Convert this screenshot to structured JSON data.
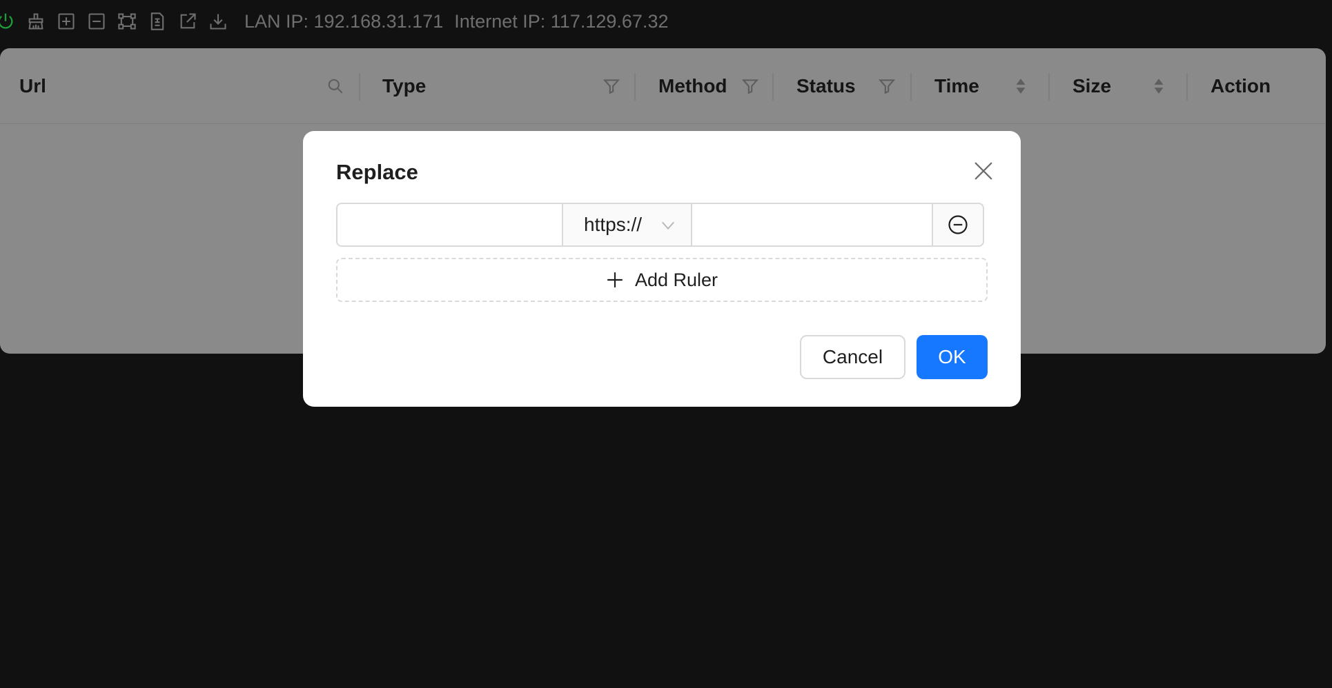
{
  "toolbar": {
    "icons": [
      "power-icon",
      "clear-icon",
      "expand-all-icon",
      "collapse-all-icon",
      "full-screen-icon",
      "copy-file-icon",
      "open-external-icon",
      "download-icon"
    ],
    "lan_ip": "LAN IP: 192.168.31.171",
    "internet_ip": "Internet IP: 117.129.67.32",
    "power_color": "#1f9d3a"
  },
  "table": {
    "columns": [
      {
        "label": "Url",
        "icon": "search-icon"
      },
      {
        "label": "Type",
        "icon": "filter-icon"
      },
      {
        "label": "Method",
        "icon": "filter-icon"
      },
      {
        "label": "Status",
        "icon": "filter-icon"
      },
      {
        "label": "Time",
        "icon": "sort-icon"
      },
      {
        "label": "Size",
        "icon": "sort-icon"
      },
      {
        "label": "Action",
        "icon": ""
      }
    ]
  },
  "modal": {
    "title": "Replace",
    "rule": {
      "match_value": "",
      "protocol": "https://",
      "target_value": ""
    },
    "add_ruler_label": "Add Ruler",
    "cancel_label": "Cancel",
    "ok_label": "OK",
    "primary_color": "#1677ff"
  }
}
